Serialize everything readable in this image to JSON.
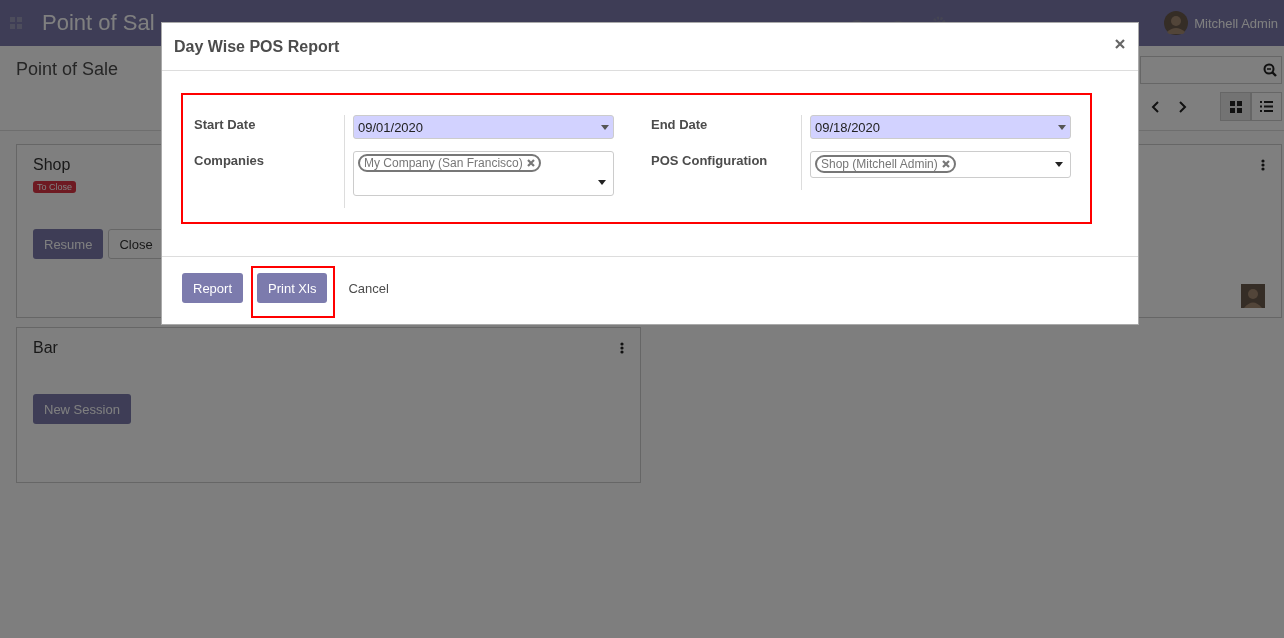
{
  "navbar": {
    "app_title": "Point of Sal",
    "user": "Mitchell Admin"
  },
  "control_panel": {
    "breadcrumb": "Point of Sale"
  },
  "cards": [
    {
      "title": "Shop",
      "badge": "To Close",
      "buttons": [
        {
          "label": "Resume",
          "kind": "primary"
        },
        {
          "label": "Close",
          "kind": "secondary"
        }
      ]
    },
    {
      "menu": true,
      "avatar": true
    },
    {
      "title": "Bar",
      "menu": true,
      "buttons": [
        {
          "label": "New Session",
          "kind": "primary"
        }
      ]
    }
  ],
  "dialog": {
    "title": "Day Wise POS Report",
    "form_highlighted": true,
    "groups": [
      {
        "fields": [
          {
            "label": "Start Date",
            "kind": "date",
            "value": "09/01/2020",
            "required": true
          },
          {
            "label": "Companies",
            "kind": "tags",
            "tags": [
              "My Company (San Francisco)"
            ],
            "required": false
          }
        ]
      },
      {
        "fields": [
          {
            "label": "End Date",
            "kind": "date",
            "value": "09/18/2020",
            "required": true
          },
          {
            "label": "POS Configuration",
            "kind": "tags",
            "tags": [
              "Shop (Mitchell Admin)"
            ],
            "required": false
          }
        ]
      }
    ],
    "buttons": [
      {
        "label": "Report",
        "kind": "primary",
        "highlighted": false
      },
      {
        "label": "Print Xls",
        "kind": "primary",
        "highlighted": true
      },
      {
        "label": "Cancel",
        "kind": "link",
        "highlighted": false
      }
    ]
  }
}
